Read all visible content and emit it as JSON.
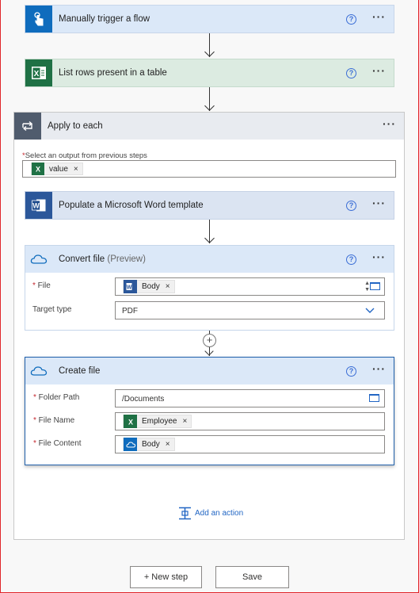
{
  "steps": {
    "trigger": {
      "title": "Manually trigger a flow",
      "help": "?",
      "more": "···",
      "color": "#0f6cbd"
    },
    "list_rows": {
      "title": "List rows present in a table",
      "help": "?",
      "more": "···",
      "color": "#1f7145"
    },
    "apply_each": {
      "title": "Apply to each",
      "more": "···",
      "color": "#505c6d",
      "select_label": "Select an output from previous steps",
      "required_mark": "*",
      "value_token": "value",
      "token_remove": "×"
    },
    "populate": {
      "title": "Populate a Microsoft Word template",
      "help": "?",
      "more": "···",
      "color": "#2b579a"
    },
    "convert": {
      "title": "Convert file",
      "preview": "(Preview)",
      "help": "?",
      "more": "···",
      "file_label": "File",
      "file_token": "Body",
      "target_label": "Target type",
      "target_value": "PDF"
    },
    "create": {
      "title": "Create file",
      "help": "?",
      "more": "···",
      "folder_label": "Folder Path",
      "folder_value": "/Documents",
      "name_label": "File Name",
      "name_token": "Employee",
      "content_label": "File Content",
      "content_token": "Body"
    }
  },
  "add_action": "Add an action",
  "insert_step": "+",
  "buttons": {
    "new_step": "+ New step",
    "save": "Save"
  }
}
